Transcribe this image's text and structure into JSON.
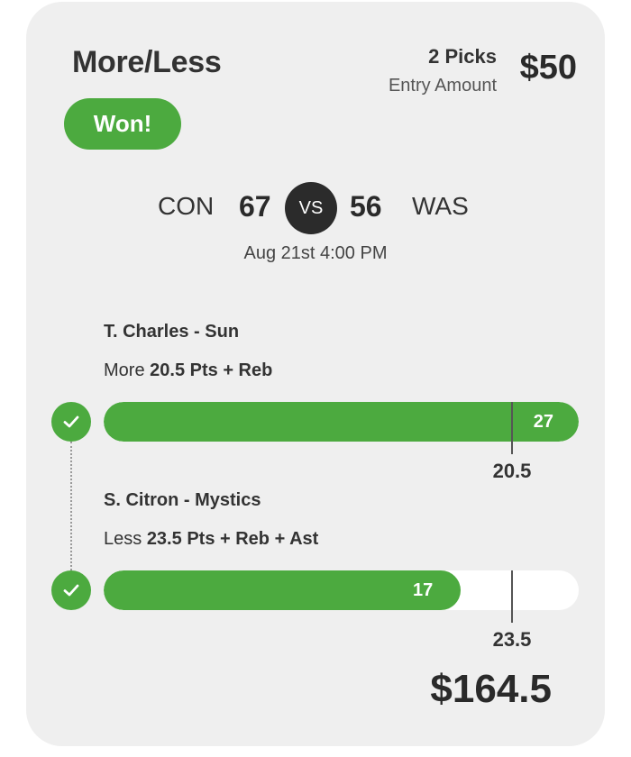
{
  "header": {
    "title": "More/Less",
    "picks": "2 Picks",
    "entry_label": "Entry Amount",
    "entry_amount": "$50"
  },
  "status": {
    "label": "Won!",
    "color": "#4caa3f"
  },
  "game": {
    "home_team": "CON",
    "home_score": "67",
    "vs_label": "VS",
    "away_score": "56",
    "away_team": "WAS",
    "datetime": "Aug 21st 4:00 PM"
  },
  "picks": [
    {
      "player": "T. Charles - Sun",
      "direction": "More",
      "line": "20.5",
      "stat": "Pts + Reb",
      "actual": "27",
      "result_icon": "check-icon"
    },
    {
      "player": "S. Citron - Mystics",
      "direction": "Less",
      "line": "23.5",
      "stat": "Pts + Reb + Ast",
      "actual": "17",
      "result_icon": "check-icon"
    }
  ],
  "payout": "$164.5",
  "colors": {
    "accent": "#4caa3f",
    "card_bg": "#efefef",
    "vs_bg": "#2b2b2b"
  }
}
